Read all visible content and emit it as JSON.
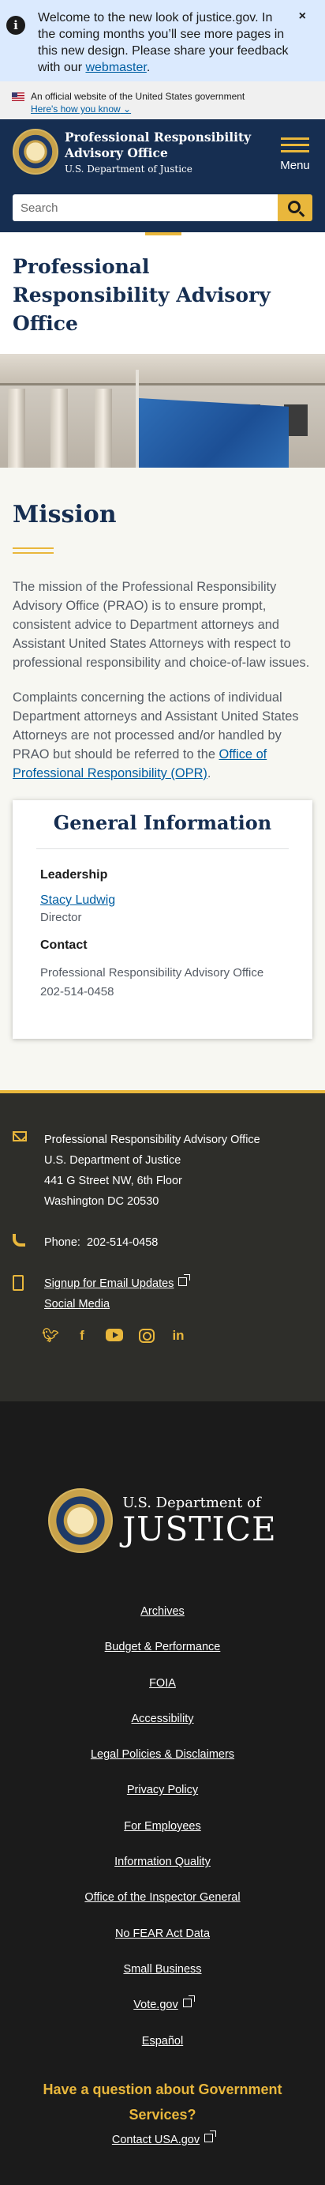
{
  "alert": {
    "text": "Welcome to the new look of justice.gov. In the coming months you’ll see more pages in this new design. Please share your feedback with our ",
    "link": "webmaster",
    "suffix": ".",
    "close": "×"
  },
  "gov_banner": {
    "text": "An official website of the United States government",
    "how": "Here's how you know"
  },
  "header": {
    "title_line1": "Professional Responsibility",
    "title_line2": "Advisory Office",
    "subtitle": "U.S. Department of Justice",
    "menu_label": "Menu",
    "search_placeholder": "Search"
  },
  "page_title": "Professional Responsibility Advisory Office",
  "mission": {
    "heading": "Mission",
    "p1": "The mission of the Professional Responsibility Advisory Office (PRAO) is to ensure prompt, consistent advice to Department attorneys and Assistant United States Attorneys with respect to professional responsibility and choice-of-law issues.",
    "p2": "Complaints concerning the actions of individual Department attorneys and Assistant United States Attorneys are not processed and/or handled by PRAO but should be referred to the ",
    "p2_link": "Office of Professional Responsibility (OPR)",
    "p2_end": "."
  },
  "general_info": {
    "heading": "General Information",
    "leadership_label": "Leadership",
    "leader_name": "Stacy Ludwig",
    "leader_title": "Director",
    "contact_label": "Contact",
    "contact_office": "Professional Responsibility Advisory Office",
    "contact_phone": "202-514-0458"
  },
  "contact_footer": {
    "address": [
      "Professional Responsibility Advisory Office",
      "U.S. Department of Justice",
      "441 G Street NW, 6th Floor",
      "Washington DC 20530"
    ],
    "phone_label": "Phone:",
    "phone": "202-514-0458",
    "signup": "Signup for Email Updates",
    "social": "Social Media"
  },
  "bottom_footer": {
    "doj_line1": "U.S. Department of",
    "doj_line2": "JUSTICE",
    "links": [
      "Archives",
      "Budget & Performance",
      "FOIA",
      "Accessibility",
      "Legal Policies & Disclaimers",
      "Privacy Policy",
      "For Employees",
      "Information Quality",
      "Office of the Inspector General",
      "No FEAR Act Data",
      "Small Business",
      "Vote.gov",
      "Español"
    ],
    "question": "Have a question about Government Services?",
    "contact_usa": "Contact USA.gov"
  },
  "colors": {
    "navy": "#162e51",
    "gold": "#e9b73c",
    "link": "#005ea2"
  }
}
